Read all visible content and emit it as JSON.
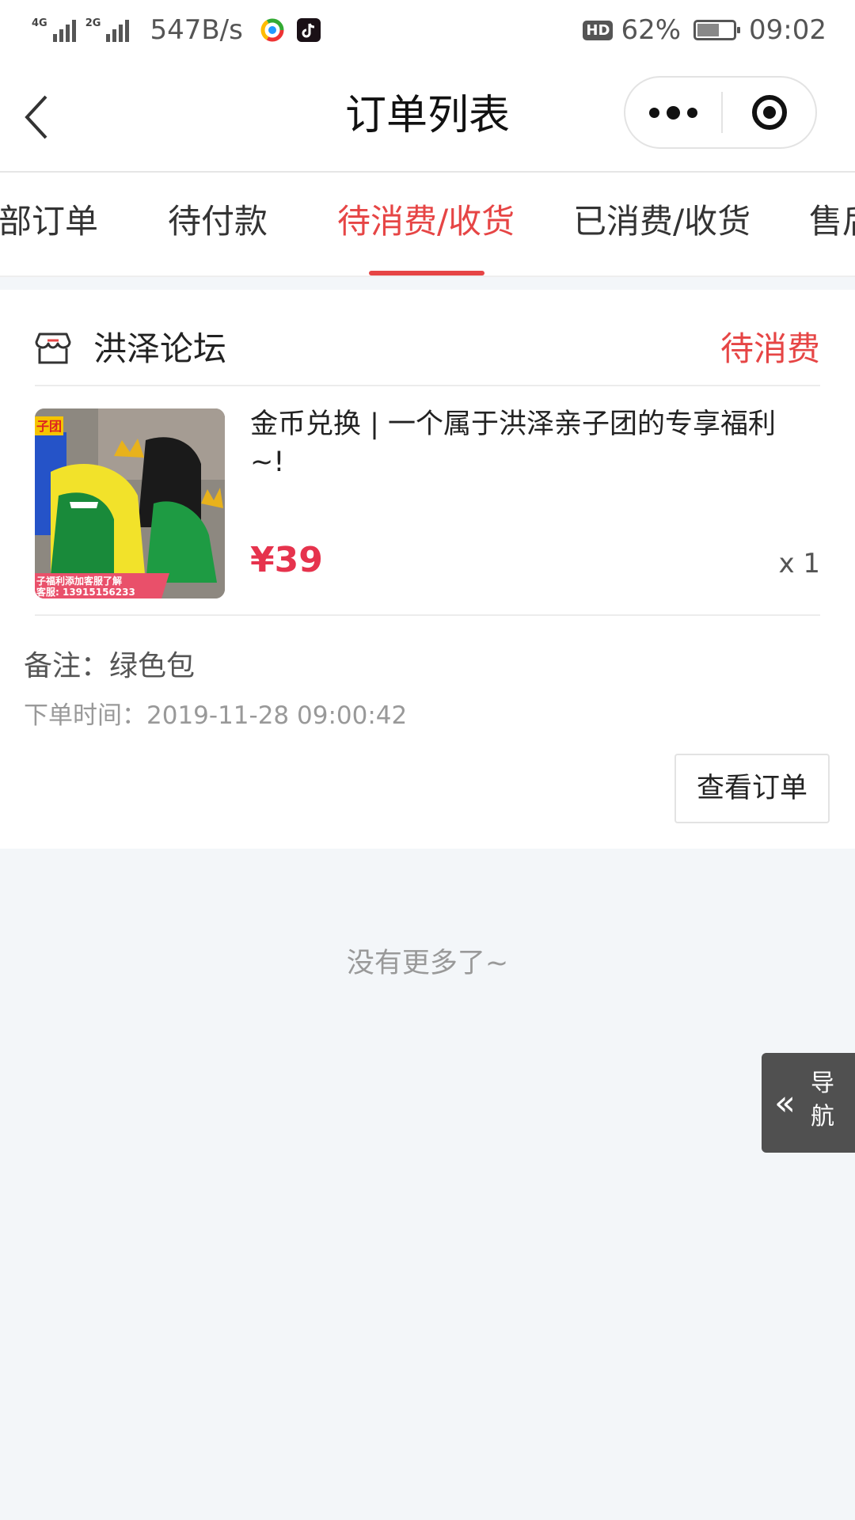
{
  "status_bar": {
    "net1": "4G",
    "net2": "2G",
    "speed": "547B/s",
    "hd_label": "HD",
    "battery": "62%",
    "battery_level": 0.62,
    "time": "09:02"
  },
  "navbar": {
    "title": "订单列表"
  },
  "tabs": [
    {
      "label": "全部订单",
      "active": false
    },
    {
      "label": "待付款",
      "active": false
    },
    {
      "label": "待消费/收货",
      "active": true
    },
    {
      "label": "已消费/收货",
      "active": false
    },
    {
      "label": "售后",
      "active": false
    }
  ],
  "order": {
    "shop_name": "洪泽论坛",
    "status": "待消费",
    "product_title": "金币兑换 | 一个属于洪泽亲子团的专享福利~!",
    "price": "¥39",
    "quantity": "x 1",
    "remark": "备注：绿色包",
    "order_time": "下单时间：2019-11-28 09:00:42",
    "view_button": "查看订单",
    "image_banner": "子福利添加客服了解",
    "image_phone": "客服: 13915156233",
    "image_tag": "子团"
  },
  "footer": {
    "no_more": "没有更多了~"
  },
  "float_nav": {
    "label": "导航",
    "icon": "double-chevron-left-icon"
  },
  "colors": {
    "accent": "#e64545",
    "price": "#e6334d",
    "background": "#f3f6f9"
  }
}
